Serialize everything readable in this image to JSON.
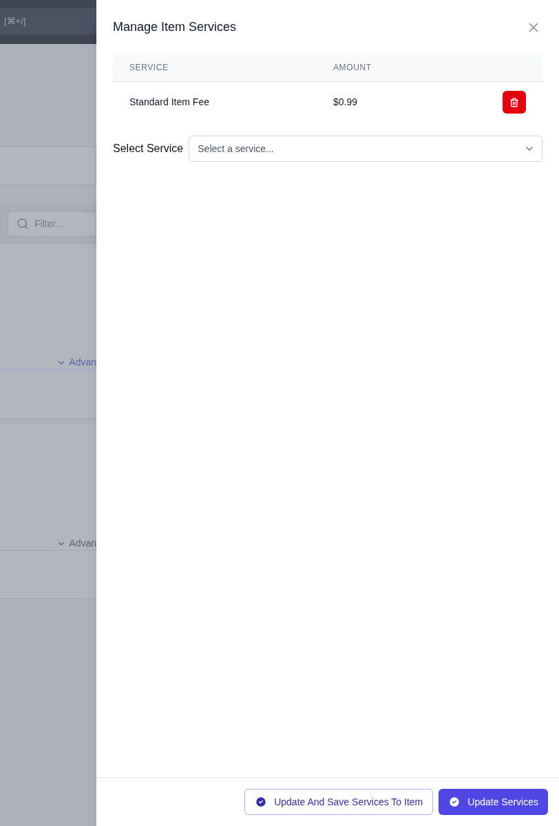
{
  "background": {
    "shortcut_hint": "[⌘+/]",
    "filter": {
      "placeholder": "Filter..."
    },
    "advanced_toggles": [
      {
        "label": "Advan",
        "kind": "link"
      },
      {
        "label": "Advan",
        "kind": "plain"
      }
    ]
  },
  "panel": {
    "title": "Manage Item Services",
    "table": {
      "columns": [
        "SERVICE",
        "AMOUNT"
      ],
      "rows": [
        {
          "service": "Standard Item Fee",
          "amount": "$0.99"
        }
      ]
    },
    "select": {
      "label": "Select Service",
      "placeholder": "Select a service..."
    },
    "buttons": [
      {
        "label": "Update And Save Services To Item",
        "kind": "secondary"
      },
      {
        "label": "Update Services",
        "kind": "primary"
      }
    ]
  }
}
